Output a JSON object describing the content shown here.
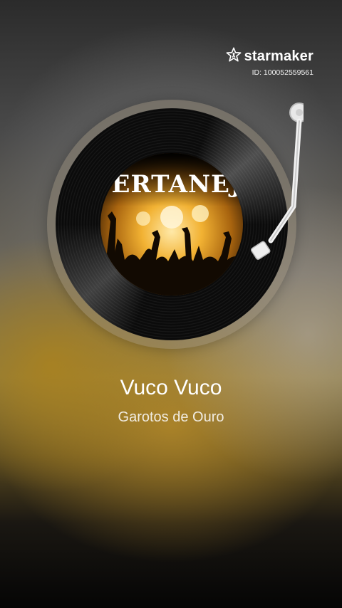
{
  "brand": {
    "name": "starmaker",
    "user_id": "ID: 100052559561",
    "icon": "star-person-icon"
  },
  "album_cover": {
    "text": "SERTANEJO",
    "icon": "concert-crowd-image"
  },
  "song": {
    "title": "Vuco Vuco",
    "artist": "Garotos de Ouro"
  },
  "colors": {
    "accent_gold": "#B8902C",
    "text": "#FFFFFF"
  }
}
